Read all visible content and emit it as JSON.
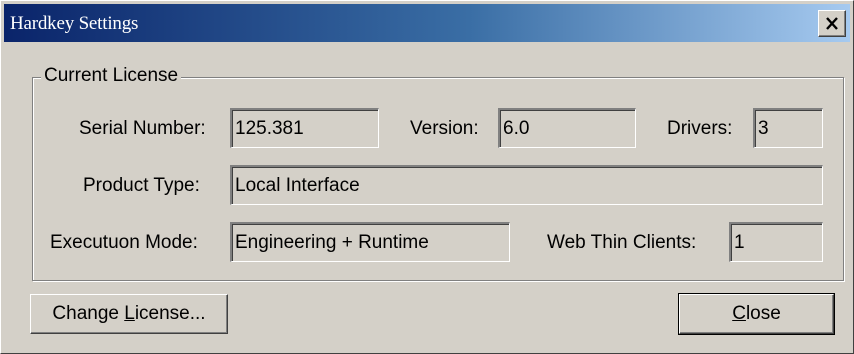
{
  "window": {
    "title": "Hardkey Settings"
  },
  "group": {
    "legend": "Current License"
  },
  "fields": {
    "serial_label": "Serial Number:",
    "serial_value": "125.381",
    "version_label": "Version:",
    "version_value": "6.0",
    "drivers_label": "Drivers:",
    "drivers_value": "3",
    "product_label": "Product Type:",
    "product_value": "Local Interface",
    "mode_label": "Executuon Mode:",
    "mode_value": "Engineering + Runtime",
    "thin_label": "Web Thin Clients:",
    "thin_value": "1"
  },
  "buttons": {
    "change_prefix": "Change ",
    "change_accel": "L",
    "change_rest": "icense...",
    "close_accel": "C",
    "close_rest": "lose"
  },
  "icons": {
    "close": "close-icon"
  }
}
